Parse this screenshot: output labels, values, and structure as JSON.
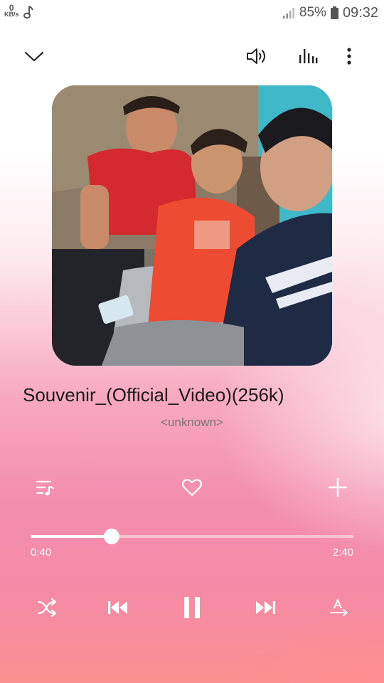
{
  "status_bar": {
    "net_speed_value": "0",
    "net_speed_unit": "KB/s",
    "battery_percent": "85%",
    "time": "09:32",
    "icons": [
      "music-note-icon",
      "signal-icon",
      "battery-icon"
    ]
  },
  "header": {
    "icons": [
      "chevron-down-icon",
      "volume-icon",
      "equalizer-icon",
      "more-vert-icon"
    ]
  },
  "album_art": {
    "description_icon": "album-art-photo"
  },
  "track": {
    "title": "Souvenir_(Official_Video)(256k)",
    "artist": "<unknown>"
  },
  "actions": {
    "icons": [
      "playlist-icon",
      "heart-icon",
      "plus-icon"
    ]
  },
  "progress": {
    "elapsed": "0:40",
    "total": "2:40",
    "fraction": 0.25
  },
  "controls": {
    "icons": [
      "shuffle-icon",
      "previous-icon",
      "pause-icon",
      "next-icon",
      "lyrics-icon"
    ]
  },
  "colors": {
    "accent_white": "#ffffff",
    "background_pink": "#f48fb0",
    "background_coral": "#f8908f"
  }
}
